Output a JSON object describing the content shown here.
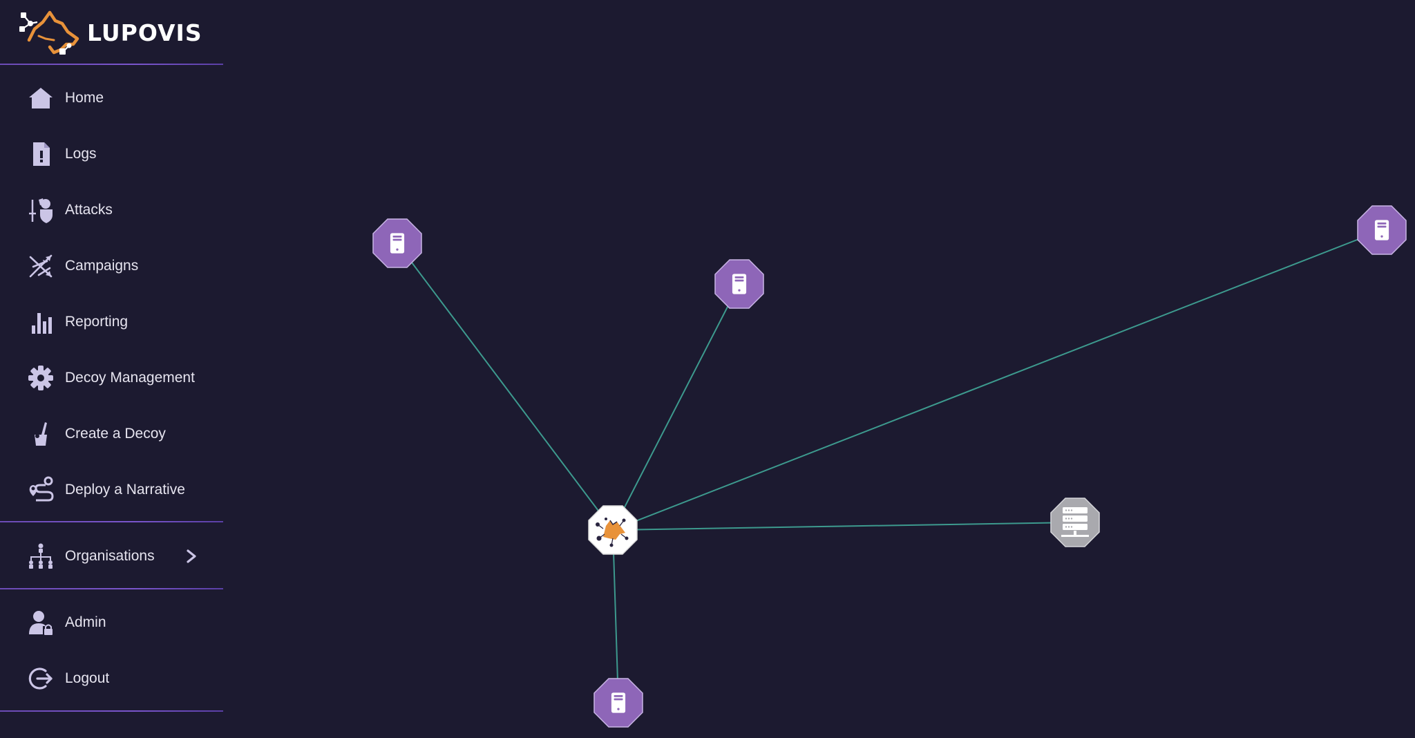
{
  "brand": {
    "name": "LUPOVIS"
  },
  "sidebar": {
    "items": [
      {
        "label": "Home",
        "icon": "home-icon"
      },
      {
        "label": "Logs",
        "icon": "log-file-icon"
      },
      {
        "label": "Attacks",
        "icon": "attacker-icon"
      },
      {
        "label": "Campaigns",
        "icon": "campaigns-icon"
      },
      {
        "label": "Reporting",
        "icon": "bar-chart-icon"
      },
      {
        "label": "Decoy Management",
        "icon": "gear-icon"
      },
      {
        "label": "Create a Decoy",
        "icon": "create-decoy-icon"
      },
      {
        "label": "Deploy a Narrative",
        "icon": "route-icon"
      }
    ],
    "organisations": {
      "label": "Organisations",
      "icon": "org-chart-icon",
      "chevron": "chevron-right-icon"
    },
    "bottom": [
      {
        "label": "Admin",
        "icon": "admin-user-icon"
      },
      {
        "label": "Logout",
        "icon": "logout-icon"
      }
    ]
  },
  "graph": {
    "center": {
      "icon": "lupovis-hub-icon"
    },
    "nodes": [
      {
        "type": "decoy-server",
        "icon": "server-tower-icon",
        "color": "#8e66b8"
      },
      {
        "type": "decoy-server",
        "icon": "server-tower-icon",
        "color": "#8e66b8"
      },
      {
        "type": "decoy-server",
        "icon": "server-tower-icon",
        "color": "#8e66b8"
      },
      {
        "type": "network-server",
        "icon": "server-rack-icon",
        "color": "#a9a9ae"
      },
      {
        "type": "decoy-server",
        "icon": "server-tower-icon",
        "color": "#8e66b8"
      }
    ]
  },
  "colors": {
    "background": "#1c1a30",
    "edge": "#3d9a8e",
    "accent": "#7a55cc",
    "node_purple": "#8e66b8",
    "node_grey": "#a9a9ae",
    "logo_orange": "#e8923a"
  }
}
